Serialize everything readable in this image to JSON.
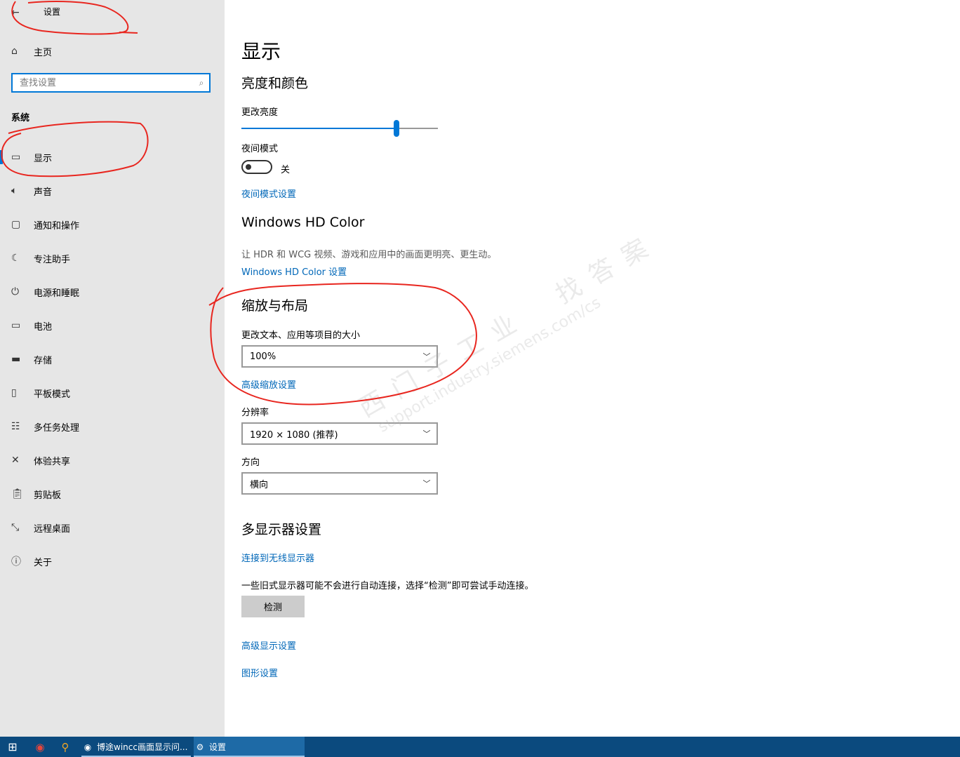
{
  "window": {
    "title": "设置"
  },
  "sidebar": {
    "home_label": "主页",
    "search_placeholder": "查找设置",
    "section_title": "系统",
    "items": [
      {
        "label": "显示",
        "icon": "monitor-icon",
        "active": true
      },
      {
        "label": "声音",
        "icon": "speaker-icon"
      },
      {
        "label": "通知和操作",
        "icon": "notification-icon"
      },
      {
        "label": "专注助手",
        "icon": "moon-icon"
      },
      {
        "label": "电源和睡眠",
        "icon": "power-icon"
      },
      {
        "label": "电池",
        "icon": "battery-icon"
      },
      {
        "label": "存储",
        "icon": "storage-icon"
      },
      {
        "label": "平板模式",
        "icon": "tablet-icon"
      },
      {
        "label": "多任务处理",
        "icon": "multitask-icon"
      },
      {
        "label": "体验共享",
        "icon": "share-icon"
      },
      {
        "label": "剪贴板",
        "icon": "clipboard-icon"
      },
      {
        "label": "远程桌面",
        "icon": "remote-desktop-icon"
      },
      {
        "label": "关于",
        "icon": "info-icon"
      }
    ]
  },
  "main": {
    "page_title": "显示",
    "brightness_section": {
      "title": "亮度和颜色",
      "brightness_label": "更改亮度",
      "brightness_value": 0.79,
      "night_mode_label": "夜间模式",
      "night_mode_state": "关",
      "night_mode_settings_link": "夜间模式设置"
    },
    "hdr_section": {
      "title": "Windows HD Color",
      "description": "让 HDR 和 WCG 视频、游戏和应用中的画面更明亮、更生动。",
      "link": "Windows HD Color 设置"
    },
    "scale_section": {
      "title": "缩放与布局",
      "scale_label": "更改文本、应用等项目的大小",
      "scale_value": "100%",
      "advanced_scale_link": "高级缩放设置",
      "resolution_label": "分辨率",
      "resolution_value": "1920 × 1080 (推荐)",
      "orientation_label": "方向",
      "orientation_value": "横向"
    },
    "multi_display_section": {
      "title": "多显示器设置",
      "wireless_link": "连接到无线显示器",
      "legacy_text": "一些旧式显示器可能不会进行自动连接，选择“检测”即可尝试手动连接。",
      "detect_button": "检测",
      "advanced_display_link": "高级显示设置",
      "graphics_link": "图形设置"
    }
  },
  "watermark": {
    "line1": "西门子工业　找答案",
    "line2": "support.industry.siemens.com/cs"
  },
  "taskbar": {
    "tasks": [
      {
        "label": "博途wincc画面显示问...",
        "icon": "chrome-icon"
      },
      {
        "label": "设置",
        "icon": "gear-icon",
        "active": true
      }
    ]
  },
  "colors": {
    "accent": "#0078d7",
    "link": "#0067b8",
    "taskbar": "#0b4a7e",
    "annotation": "#e8261f"
  }
}
